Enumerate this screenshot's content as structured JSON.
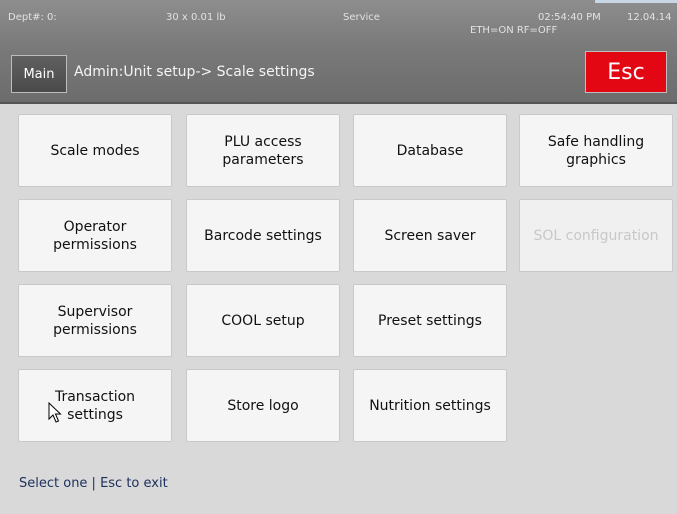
{
  "status_bar": {
    "dept": "Dept#: 0:",
    "weight": "30 x 0.01 lb",
    "mode": "Service",
    "time": "02:54:40 PM",
    "date": "12.04.14",
    "network": "ETH=ON  RF=OFF"
  },
  "header": {
    "main_label": "Main",
    "breadcrumb": "Admin:Unit setup-> Scale settings",
    "esc_label": "Esc"
  },
  "menu": {
    "items": [
      {
        "label": "Scale modes",
        "enabled": true
      },
      {
        "label": "PLU access parameters",
        "enabled": true
      },
      {
        "label": "Database",
        "enabled": true
      },
      {
        "label": "Safe handling graphics",
        "enabled": true
      },
      {
        "label": "Operator permissions",
        "enabled": true
      },
      {
        "label": "Barcode settings",
        "enabled": true
      },
      {
        "label": "Screen saver",
        "enabled": true
      },
      {
        "label": "SOL configuration",
        "enabled": false
      },
      {
        "label": "Supervisor permissions",
        "enabled": true
      },
      {
        "label": "COOL setup",
        "enabled": true
      },
      {
        "label": "Preset settings",
        "enabled": true
      },
      {
        "label": "Transaction settings",
        "enabled": true
      },
      {
        "label": "Store logo",
        "enabled": true
      },
      {
        "label": "Nutrition settings",
        "enabled": true
      }
    ]
  },
  "footer": {
    "hint": "Select one | Esc to exit"
  },
  "colors": {
    "esc_red": "#e30613",
    "header_gray": "#7a7a7a",
    "background": "#d9d9d9"
  },
  "icons": {
    "cursor": "mouse-pointer-icon"
  }
}
